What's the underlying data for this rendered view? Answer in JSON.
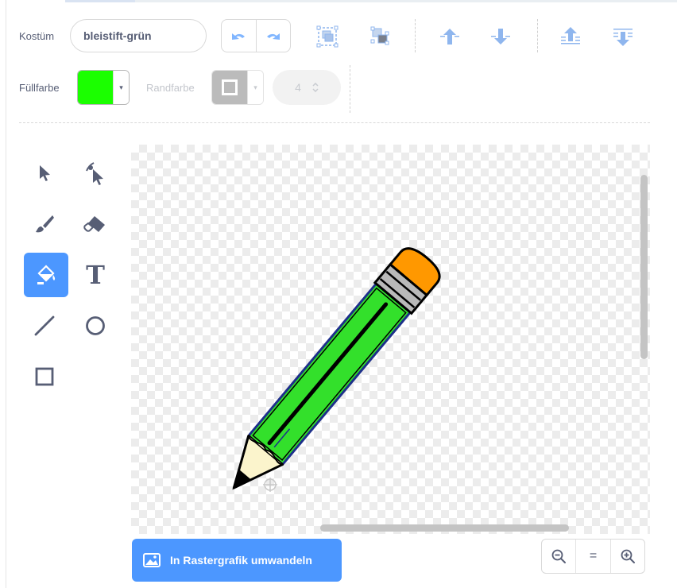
{
  "header": {
    "costume_label": "Kostüm",
    "costume_name": "bleistift-grün"
  },
  "toolbar": {
    "undo_icon": "undo-icon",
    "redo_icon": "redo-icon",
    "group_icon": "group-icon",
    "ungroup_icon": "ungroup-icon",
    "forward_icon": "forward-icon",
    "backward_icon": "backward-icon",
    "front_icon": "front-icon",
    "back_icon": "back-icon"
  },
  "style": {
    "fill_label": "Füllfarbe",
    "fill_color": "#1bff00",
    "outline_label": "Randfarbe",
    "outline_color": "#b4b4b4",
    "stroke_width": "4",
    "dropdown_arrow": "▾"
  },
  "tools": [
    {
      "name": "select",
      "icon": "select-arrow-icon",
      "active": false
    },
    {
      "name": "reshape",
      "icon": "reshape-icon",
      "active": false
    },
    {
      "name": "brush",
      "icon": "brush-icon",
      "active": false
    },
    {
      "name": "eraser",
      "icon": "eraser-icon",
      "active": false
    },
    {
      "name": "fill",
      "icon": "fill-bucket-icon",
      "active": true
    },
    {
      "name": "text",
      "icon": "text-icon",
      "active": false,
      "glyph": "T"
    },
    {
      "name": "line",
      "icon": "line-icon",
      "active": false
    },
    {
      "name": "circle",
      "icon": "circle-icon",
      "active": false
    },
    {
      "name": "rectangle",
      "icon": "rectangle-icon",
      "active": false
    }
  ],
  "footer": {
    "bitmap_label": "In Rastergrafik umwandeln",
    "zoom_out_icon": "zoom-out-icon",
    "zoom_reset_label": "=",
    "zoom_in_icon": "zoom-in-icon"
  },
  "colors": {
    "accent": "#4c97ff",
    "text": "#575e75",
    "pencil_body": "#33e02b",
    "pencil_eraser": "#ff9800"
  }
}
